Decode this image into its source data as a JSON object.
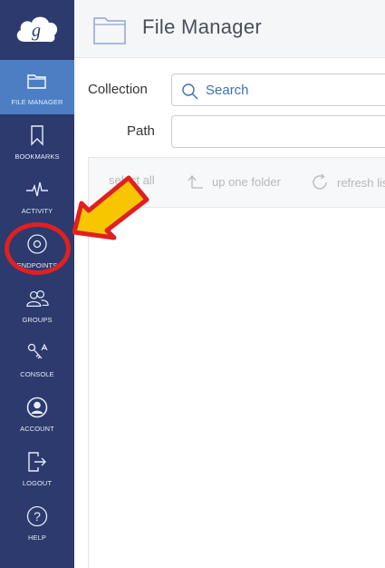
{
  "app": {
    "logo": "globus-logo"
  },
  "sidebar": {
    "items": [
      {
        "label": "FILE MANAGER",
        "icon": "folder-icon",
        "active": true
      },
      {
        "label": "BOOKMARKS",
        "icon": "bookmark-icon",
        "active": false
      },
      {
        "label": "ACTIVITY",
        "icon": "activity-pulse-icon",
        "active": false
      },
      {
        "label": "ENDPOINTS",
        "icon": "endpoints-icon",
        "active": false
      },
      {
        "label": "GROUPS",
        "icon": "groups-icon",
        "active": false
      },
      {
        "label": "CONSOLE",
        "icon": "console-icon",
        "active": false
      },
      {
        "label": "ACCOUNT",
        "icon": "account-icon",
        "active": false
      },
      {
        "label": "LOGOUT",
        "icon": "logout-icon",
        "active": false
      },
      {
        "label": "HELP",
        "icon": "help-icon",
        "active": false
      }
    ]
  },
  "header": {
    "title": "File Manager"
  },
  "form": {
    "collection_label": "Collection",
    "search_placeholder": "Search",
    "path_label": "Path",
    "path_value": ""
  },
  "toolbar": {
    "select_all": "select all",
    "up_one_folder": "up one folder",
    "refresh_list": "refresh list"
  },
  "colors": {
    "sidebar": "#2c3a6e",
    "active": "#4d7ec4",
    "accent": "#3e6fb5",
    "annotation_red": "#e02020",
    "annotation_yellow": "#f7c600"
  }
}
